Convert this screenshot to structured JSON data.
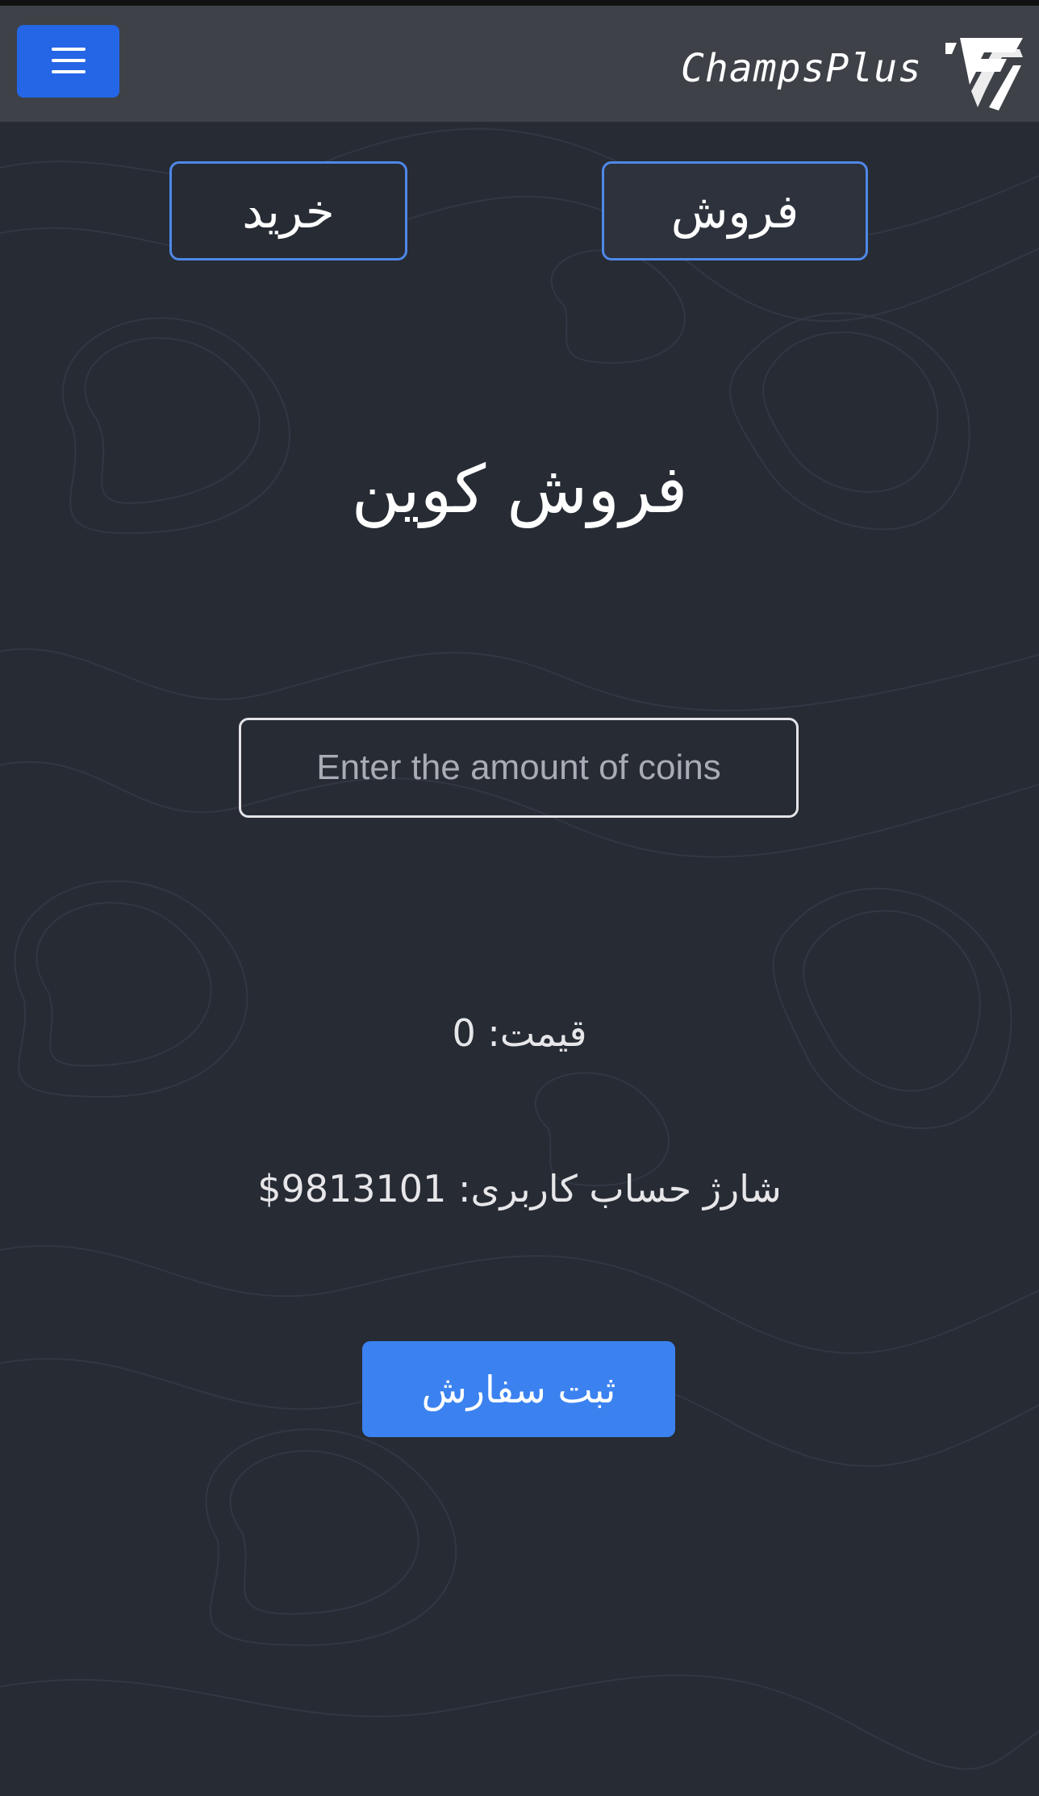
{
  "header": {
    "brand": "ChampsPlus",
    "menu_icon": "hamburger-menu-icon",
    "logo_icon": "fc-logo-icon",
    "accent_color": "#2566e6"
  },
  "tabs": {
    "buy_label": "خرید",
    "sell_label": "فروش"
  },
  "main": {
    "title": "فروش کوین",
    "amount_input": {
      "value": "",
      "placeholder": "Enter the amount of coins"
    },
    "price_text": "قیمت: 0",
    "balance_text": "شارژ حساب کاربری: 9813101$",
    "submit_label": "ثبت سفارش"
  }
}
